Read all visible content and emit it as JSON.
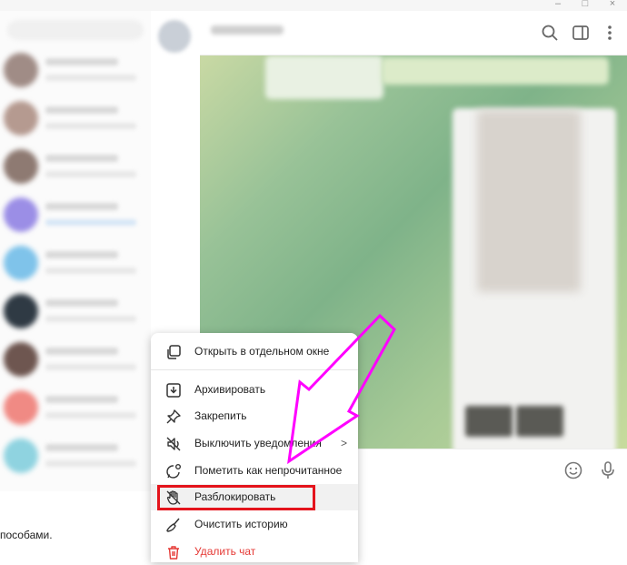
{
  "menu": {
    "items": [
      {
        "label": "Открыть в отдельном окне",
        "icon": "open-window-icon"
      },
      {
        "label": "Архивировать",
        "icon": "archive-icon"
      },
      {
        "label": "Закрепить",
        "icon": "pin-icon"
      },
      {
        "label": "Выключить уведомления",
        "icon": "mute-icon",
        "submenu_arrow": ">"
      },
      {
        "label": "Пометить как непрочитанное",
        "icon": "mark-unread-icon"
      },
      {
        "label": "Разблокировать",
        "icon": "unblock-hand-icon"
      },
      {
        "label": "Очистить историю",
        "icon": "broom-icon"
      },
      {
        "label": "Удалить чат",
        "icon": "trash-icon"
      }
    ]
  },
  "page": {
    "background_text": "пособами."
  },
  "colors": {
    "highlight_box": "#e4141c",
    "annotation_arrow": "#ff00ff",
    "danger": "#e53935"
  },
  "window": {
    "controls": [
      "–",
      "□",
      "×"
    ]
  }
}
